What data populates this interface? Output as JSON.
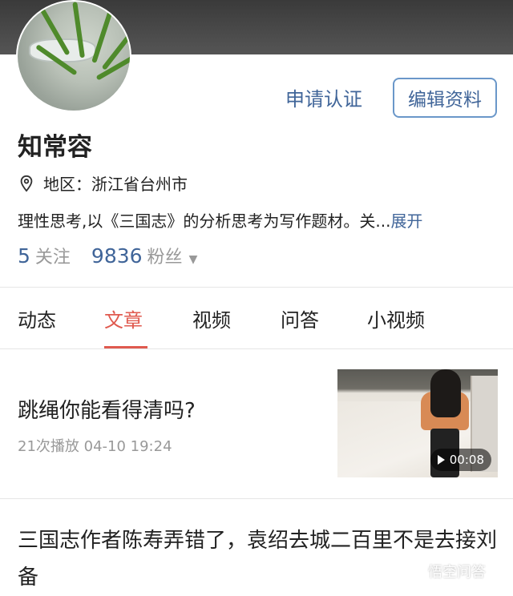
{
  "profile": {
    "apply_label": "申请认证",
    "edit_label": "编辑资料",
    "name": "知常容",
    "region": "地区：浙江省台州市",
    "bio": "理性思考,以《三国志》的分析思考为写作题材。关...",
    "bio_more": "展开",
    "following_count": "5",
    "following_label": "关注",
    "followers_count": "9836",
    "followers_label": "粉丝"
  },
  "tabs": {
    "items": [
      "动态",
      "文章",
      "视频",
      "问答",
      "小视频"
    ],
    "active": "文章"
  },
  "feed": [
    {
      "title": "跳绳你能看得清吗?",
      "meta": "21次播放   04-10 19:24",
      "duration": "00:08"
    },
    {
      "title": "三国志作者陈寿弄错了，袁绍去城二百里不是去接刘备"
    }
  ],
  "watermark": "悟空问答",
  "icons": [
    "location-pin-icon",
    "caret-down-icon",
    "play-icon"
  ],
  "colors": {
    "accent": "#e05a4f",
    "link": "#406599"
  }
}
